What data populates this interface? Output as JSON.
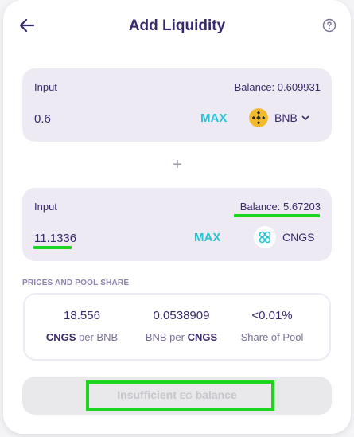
{
  "header": {
    "title": "Add Liquidity"
  },
  "input_a": {
    "label": "Input",
    "balance": "Balance: 0.609931",
    "amount": "0.6",
    "max_label": "MAX",
    "token": "BNB",
    "token_icon": "bnb-coin-icon"
  },
  "plus_sign": "+",
  "input_b": {
    "label": "Input",
    "balance": "Balance: 5.67203",
    "amount": "11.1336",
    "max_label": "MAX",
    "token": "CNGS",
    "token_icon": "cngs-coin-icon"
  },
  "pool": {
    "section_title": "PRICES AND POOL SHARE",
    "stats": [
      {
        "value": "18.556",
        "desc_bold": "CNGS",
        "desc_rest": " per BNB"
      },
      {
        "value": "0.0538909",
        "desc_rest": "BNB per ",
        "desc_bold": "CNGS"
      },
      {
        "value": "<0.01%",
        "desc_rest": "Share of Pool"
      }
    ]
  },
  "submit": {
    "part1": "Insufficient ",
    "part2": "EG",
    "part3": " balance"
  },
  "colors": {
    "title": "#3b2a6b",
    "accent": "#27c3d3",
    "panel": "#eeeaf4",
    "highlight": "#1ed41e",
    "bnb": "#f3ba2f"
  }
}
